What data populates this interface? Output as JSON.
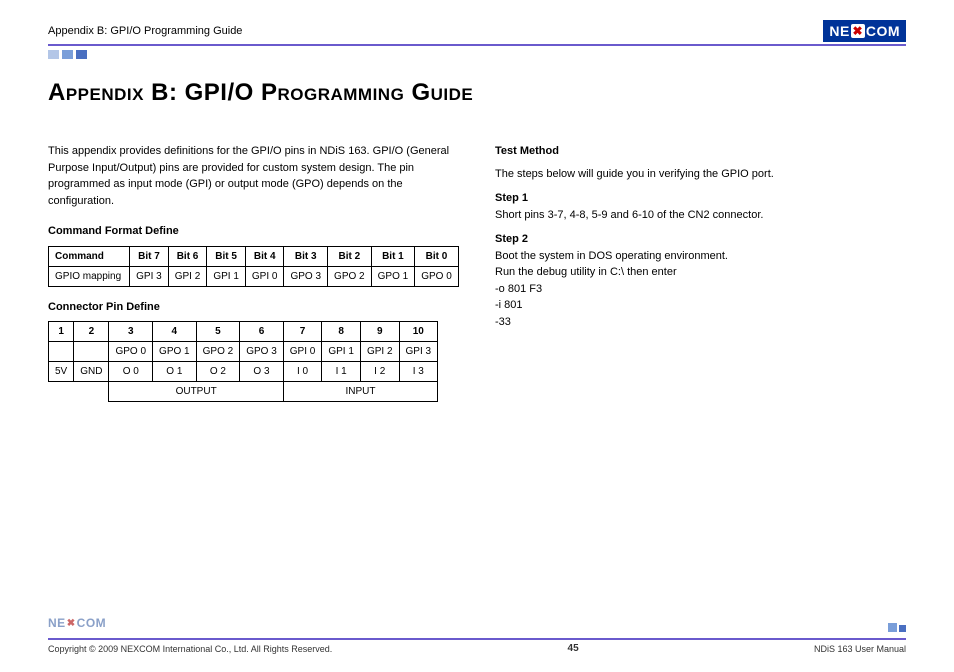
{
  "header": {
    "section": "Appendix B: GPI/O Programming Guide",
    "logo_text_left": "NE",
    "logo_text_x": "✖",
    "logo_text_right": "COM"
  },
  "title": "Appendix B: GPI/O Programming Guide",
  "intro": "This appendix provides definitions for the GPI/O pins in NDiS 163. GPI/O (General Purpose Input/Output) pins are provided for custom system design. The pin programmed as input mode (GPI) or output mode (GPO) depends on the configuration.",
  "cmd_heading": "Command Format Define",
  "cmd_table": {
    "headers": [
      "Command",
      "Bit 7",
      "Bit 6",
      "Bit 5",
      "Bit 4",
      "Bit 3",
      "Bit 2",
      "Bit 1",
      "Bit 0"
    ],
    "row": [
      "GPIO mapping",
      "GPI 3",
      "GPI 2",
      "GPI 1",
      "GPI 0",
      "GPO 3",
      "GPO 2",
      "GPO 1",
      "GPO 0"
    ]
  },
  "conn_heading": "Connector Pin Define",
  "conn_table": {
    "headers": [
      "1",
      "2",
      "3",
      "4",
      "5",
      "6",
      "7",
      "8",
      "9",
      "10"
    ],
    "row1": [
      "",
      "",
      "GPO 0",
      "GPO 1",
      "GPO 2",
      "GPO 3",
      "GPI 0",
      "GPI 1",
      "GPI 2",
      "GPI 3"
    ],
    "row2": [
      "5V",
      "GND",
      "O 0",
      "O 1",
      "O 2",
      "O 3",
      "I 0",
      "I 1",
      "I 2",
      "I 3"
    ],
    "output_label": "OUTPUT",
    "input_label": "INPUT"
  },
  "right": {
    "test_method": "Test Method",
    "test_intro": "The steps below will guide you in verifying the GPIO port.",
    "step1_label": "Step 1",
    "step1_text": "Short pins 3-7, 4-8, 5-9 and 6-10 of the CN2 connector.",
    "step2_label": "Step 2",
    "step2_line1": "Boot the system in DOS operating environment.",
    "step2_line2": "Run the debug utility in C:\\ then enter",
    "step2_line3": "-o 801 F3",
    "step2_line4": "-i 801",
    "step2_line5": "-33"
  },
  "footer": {
    "copyright": "Copyright © 2009 NEXCOM International Co., Ltd. All Rights Reserved.",
    "page": "45",
    "manual": "NDiS 163 User Manual"
  }
}
